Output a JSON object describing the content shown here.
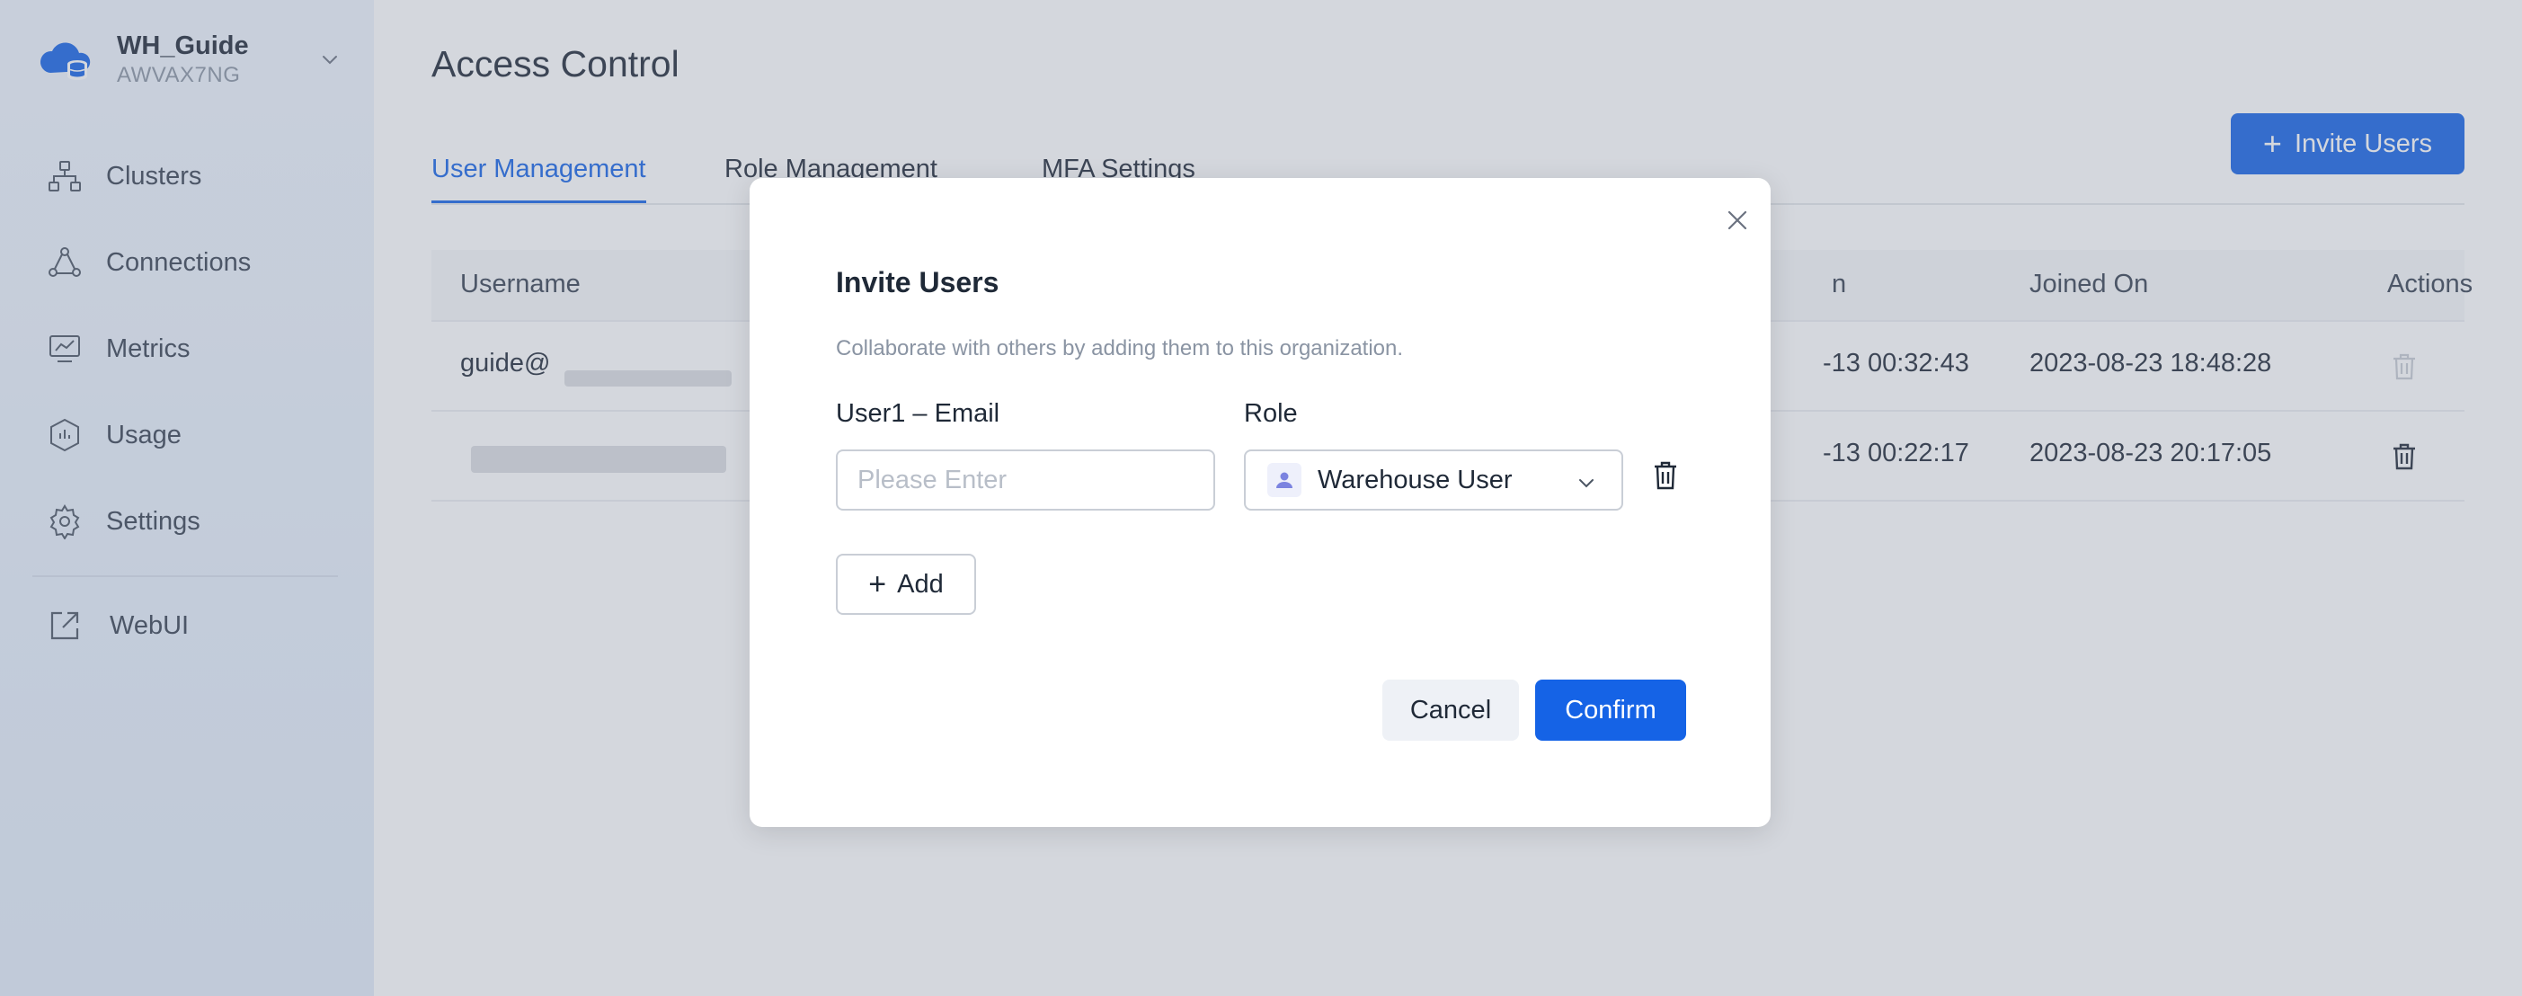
{
  "org": {
    "name": "WH_Guide",
    "id": "AWVAX7NG"
  },
  "sidebar": {
    "items": [
      {
        "label": "Clusters",
        "icon": "clusters-icon"
      },
      {
        "label": "Connections",
        "icon": "connections-icon"
      },
      {
        "label": "Metrics",
        "icon": "metrics-icon"
      },
      {
        "label": "Usage",
        "icon": "usage-icon"
      },
      {
        "label": "Settings",
        "icon": "gear-icon"
      }
    ],
    "webui": {
      "label": "WebUI",
      "icon": "external-link-icon"
    }
  },
  "page": {
    "title": "Access Control",
    "invite_button": "Invite Users",
    "tabs": [
      {
        "label": "User Management",
        "active": true
      },
      {
        "label": "Role Management",
        "active": false
      },
      {
        "label": "MFA Settings",
        "active": false
      }
    ],
    "table": {
      "columns": [
        "Username",
        "n",
        "Joined On",
        "Actions"
      ],
      "rows": [
        {
          "username": "guide@",
          "last_login": "-13 00:32:43",
          "joined_on": "2023-08-23 18:48:28",
          "delete_enabled": false
        },
        {
          "username": "",
          "last_login": "-13 00:22:17",
          "joined_on": "2023-08-23 20:17:05",
          "delete_enabled": true
        }
      ]
    }
  },
  "modal": {
    "title": "Invite Users",
    "description": "Collaborate with others by adding them to this organization.",
    "email_label": "User1 – Email",
    "email_placeholder": "Please Enter",
    "email_value": "",
    "role_label": "Role",
    "role_value": "Warehouse User",
    "add_label": "Add",
    "cancel_label": "Cancel",
    "confirm_label": "Confirm"
  },
  "colors": {
    "accent": "#1563e6",
    "overlay": "rgba(120,132,150,0.32)"
  }
}
